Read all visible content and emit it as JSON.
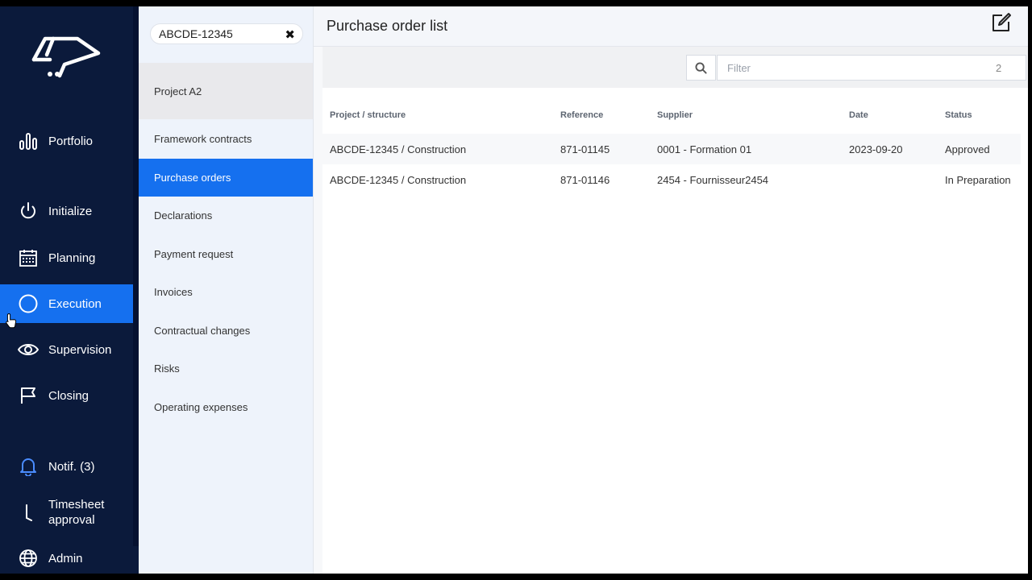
{
  "sidebar": {
    "items": [
      {
        "label": "Portfolio"
      },
      {
        "label": "Initialize"
      },
      {
        "label": "Planning"
      },
      {
        "label": "Execution"
      },
      {
        "label": "Supervision"
      },
      {
        "label": "Closing"
      },
      {
        "label": "Notif. (3)"
      },
      {
        "label": "Timesheet approval"
      },
      {
        "label": "Admin"
      }
    ],
    "active_color": "#1570ef"
  },
  "submenu": {
    "search_value": "ABCDE-12345",
    "project": "Project A2",
    "items": [
      {
        "label": "Framework contracts"
      },
      {
        "label": "Purchase orders"
      },
      {
        "label": "Declarations"
      },
      {
        "label": "Payment request"
      },
      {
        "label": "Invoices"
      },
      {
        "label": "Contractual changes"
      },
      {
        "label": "Risks"
      },
      {
        "label": "Operating expenses"
      }
    ]
  },
  "main": {
    "title": "Purchase order list",
    "filter": {
      "placeholder": "Filter",
      "count": "2"
    },
    "table": {
      "headers": [
        "Project / structure",
        "Reference",
        "Supplier",
        "Date",
        "Status"
      ],
      "rows": [
        [
          "ABCDE-12345 / Construction",
          "871-01145",
          "0001 - Formation 01",
          "2023-09-20",
          "Approved"
        ],
        [
          "ABCDE-12345 / Construction",
          "871-01146",
          "2454 - Fournisseur2454",
          "",
          "In Preparation"
        ]
      ]
    }
  }
}
